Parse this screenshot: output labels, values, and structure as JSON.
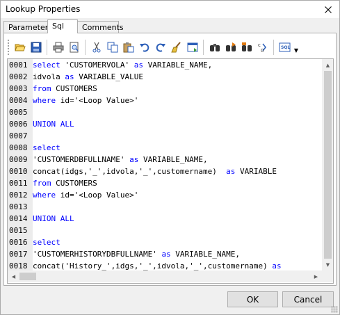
{
  "window": {
    "title": "Lookup Properties"
  },
  "tabs": [
    {
      "label": "Parameters",
      "active": false
    },
    {
      "label": "Sql",
      "active": true
    },
    {
      "label": "Comments",
      "active": false
    }
  ],
  "toolbar": {
    "buttons": [
      "open-icon",
      "save-icon",
      "print-icon",
      "print-preview-icon",
      "cut-icon",
      "copy-icon",
      "paste-icon",
      "undo-icon",
      "redo-icon",
      "clear-icon",
      "insert-icon",
      "find-icon",
      "find-next-icon",
      "find-replace-icon",
      "find-all-icon",
      "sql-format-icon"
    ]
  },
  "editor": {
    "lines": [
      {
        "num": "0001",
        "tokens": [
          [
            "select",
            true
          ],
          [
            " 'CUSTOMERVOLA' ",
            false
          ],
          [
            "as",
            true
          ],
          [
            " VARIABLE_NAME,",
            false
          ]
        ]
      },
      {
        "num": "0002",
        "tokens": [
          [
            "idvola ",
            false
          ],
          [
            "as",
            true
          ],
          [
            " VARIABLE_VALUE",
            false
          ]
        ]
      },
      {
        "num": "0003",
        "tokens": [
          [
            "from",
            true
          ],
          [
            " CUSTOMERS",
            false
          ]
        ]
      },
      {
        "num": "0004",
        "tokens": [
          [
            "where",
            true
          ],
          [
            " id='<Loop Value>'",
            false
          ]
        ]
      },
      {
        "num": "0005",
        "tokens": []
      },
      {
        "num": "0006",
        "tokens": [
          [
            "UNION ALL",
            true
          ]
        ]
      },
      {
        "num": "0007",
        "tokens": []
      },
      {
        "num": "0008",
        "tokens": [
          [
            "select",
            true
          ]
        ]
      },
      {
        "num": "0009",
        "tokens": [
          [
            "'CUSTOMERDBFULLNAME' ",
            false
          ],
          [
            "as",
            true
          ],
          [
            " VARIABLE_NAME,",
            false
          ]
        ]
      },
      {
        "num": "0010",
        "tokens": [
          [
            "concat(idgs,'_',idvola,'_',customername)  ",
            false
          ],
          [
            "as",
            true
          ],
          [
            " VARIABLE",
            false
          ]
        ]
      },
      {
        "num": "0011",
        "tokens": [
          [
            "from",
            true
          ],
          [
            " CUSTOMERS",
            false
          ]
        ]
      },
      {
        "num": "0012",
        "tokens": [
          [
            "where",
            true
          ],
          [
            " id='<Loop Value>'",
            false
          ]
        ]
      },
      {
        "num": "0013",
        "tokens": []
      },
      {
        "num": "0014",
        "tokens": [
          [
            "UNION ALL",
            true
          ]
        ]
      },
      {
        "num": "0015",
        "tokens": []
      },
      {
        "num": "0016",
        "tokens": [
          [
            "select",
            true
          ]
        ]
      },
      {
        "num": "0017",
        "tokens": [
          [
            "'CUSTOMERHISTORYDBFULLNAME' ",
            false
          ],
          [
            "as",
            true
          ],
          [
            " VARIABLE_NAME,",
            false
          ]
        ]
      },
      {
        "num": "0018",
        "tokens": [
          [
            "concat('History_',idgs,'_',idvola,'_',customername) ",
            false
          ],
          [
            "as",
            true
          ]
        ]
      }
    ]
  },
  "buttons": {
    "ok": "OK",
    "cancel": "Cancel"
  },
  "colors": {
    "keyword": "#0000ff",
    "text": "#000000",
    "gutter": "#ececec"
  }
}
